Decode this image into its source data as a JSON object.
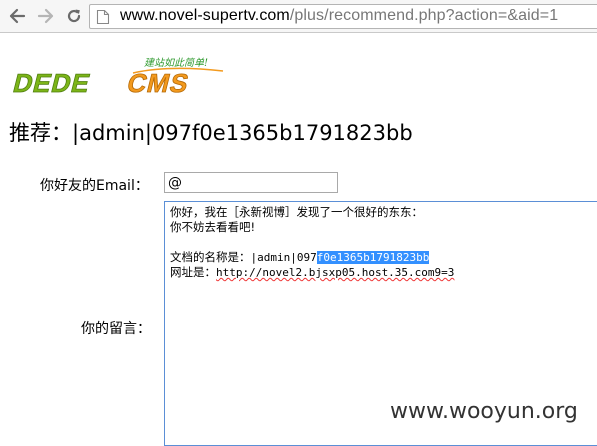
{
  "browser": {
    "back_icon": "back-arrow-icon",
    "forward_icon": "forward-arrow-icon",
    "reload_icon": "reload-icon",
    "page_icon": "page-icon",
    "url_host": "www.novel-supertv.com",
    "url_path": "/plus/recommend.php?action=&aid=1"
  },
  "logo": {
    "brand": "DEDECMS",
    "slogan": "建站如此简单!"
  },
  "page": {
    "title": "推荐：|admin|097f0e1365b1791823bb"
  },
  "form": {
    "email_label": "你好友的Email：",
    "email_value": "@",
    "message_label": "你的留言：",
    "message": {
      "line1": "你好，我在［永新视博］发现了一个很好的东东：",
      "line2": "你不妨去看看吧!",
      "doc_prefix": "文档的名称是：",
      "doc_plain": "|admin|097",
      "doc_selected": "f0e1365b1791823bb",
      "url_prefix": "网址是：",
      "url_value": "http://novel2.bjsxp05.host.35.com9=3"
    }
  },
  "watermark": "www.wooyun.org",
  "colors": {
    "accent_green": "#7cb518",
    "accent_orange": "#f39a1e",
    "selection": "#3390ff",
    "textarea_focus_border": "#5b8fd6"
  }
}
